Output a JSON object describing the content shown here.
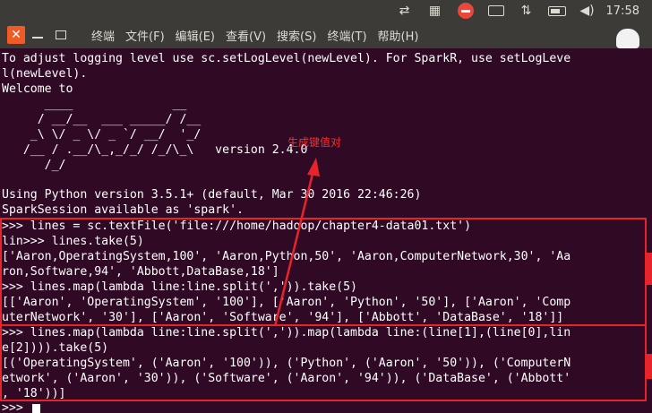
{
  "system_panel": {
    "clock": "17:58",
    "icons": [
      "transfer-icon",
      "calendar-icon",
      "stop-icon",
      "keyboard-icon",
      "network-icon",
      "battery-icon",
      "volume-icon"
    ]
  },
  "window": {
    "close_label": "✕",
    "menu": [
      "终端",
      "文件(F)",
      "编辑(E)",
      "查看(V)",
      "搜索(S)",
      "终端(T)",
      "帮助(H)"
    ]
  },
  "terminal": {
    "lines": [
      "To adjust logging level use sc.setLogLevel(newLevel). For SparkR, use setLogLeve",
      "l(newLevel).",
      "Welcome to",
      "      ____              __",
      "     / __/__  ___ _____/ /__",
      "    _\\ \\/ _ \\/ _ `/ __/  '_/",
      "   /__ / .__/\\_,_/_/ /_/\\_\\   version 2.4.0",
      "      /_/",
      "",
      "Using Python version 3.5.1+ (default, Mar 30 2016 22:46:26)",
      "SparkSession available as 'spark'.",
      ">>> lines = sc.textFile('file:///home/hadoop/chapter4-data01.txt')",
      "lin>>> lines.take(5)",
      "['Aaron,OperatingSystem,100', 'Aaron,Python,50', 'Aaron,ComputerNetwork,30', 'Aa",
      "ron,Software,94', 'Abbott,DataBase,18']",
      ">>> lines.map(lambda line:line.split(',')).take(5)",
      "[['Aaron', 'OperatingSystem', '100'], ['Aaron', 'Python', '50'], ['Aaron', 'Comp",
      "uterNetwork', '30'], ['Aaron', 'Software', '94'], ['Abbott', 'DataBase', '18']]",
      ">>> lines.map(lambda line:line.split(',')).map(lambda line:(line[1],(line[0],lin",
      "e[2]))).take(5)",
      "[('OperatingSystem', ('Aaron', '100')), ('Python', ('Aaron', '50')), ('ComputerN",
      "etwork', ('Aaron', '30')), ('Software', ('Aaron', '94')), ('DataBase', ('Abbott'",
      ", '18'))]",
      ">>> "
    ]
  },
  "annotation": {
    "label": "生成键值对",
    "color": "#e8242a"
  }
}
